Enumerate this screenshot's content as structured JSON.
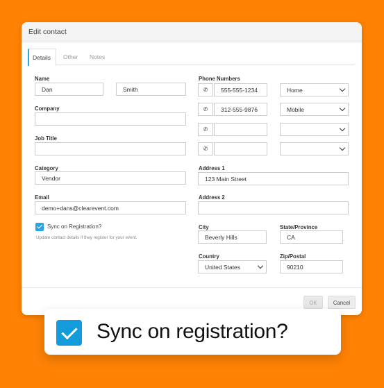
{
  "dialog": {
    "title": "Edit contact",
    "tabs": [
      {
        "label": "Details",
        "active": true
      },
      {
        "label": "Other",
        "active": false
      },
      {
        "label": "Notes",
        "active": false
      }
    ],
    "ok_label": "OK",
    "cancel_label": "Cancel"
  },
  "form": {
    "name_label": "Name",
    "first_name": "Dan",
    "last_name": "Smith",
    "company_label": "Company",
    "company": "",
    "job_title_label": "Job Title",
    "job_title": "",
    "category_label": "Category",
    "category": "Vendor",
    "email_label": "Email",
    "email": "demo+dans@clearevent.com",
    "sync_label": "Sync on Registration?",
    "sync_checked": true,
    "sync_hint": "Update contact details if they register for your event.",
    "phone_label": "Phone Numbers",
    "phones": [
      {
        "number": "555-555-1234",
        "type": "Home"
      },
      {
        "number": "312-555-9876",
        "type": "Mobile"
      },
      {
        "number": "",
        "type": ""
      },
      {
        "number": "",
        "type": ""
      }
    ],
    "address1_label": "Address 1",
    "address1": "123 Main Street",
    "address2_label": "Address 2",
    "address2": "",
    "city_label": "City",
    "city": "Beverly Hills",
    "state_label": "State/Province",
    "state": "CA",
    "country_label": "Country",
    "country": "United States",
    "zip_label": "Zip/Postal",
    "zip": "90210"
  },
  "callout": {
    "text": "Sync on registration?",
    "checked": true
  },
  "colors": {
    "background": "#FF8205",
    "accent": "#29A8E0",
    "checkbox": "#139BDB"
  },
  "icons": {
    "phone": "phone-icon",
    "chevron": "chevron-down-icon",
    "check": "check-icon"
  }
}
